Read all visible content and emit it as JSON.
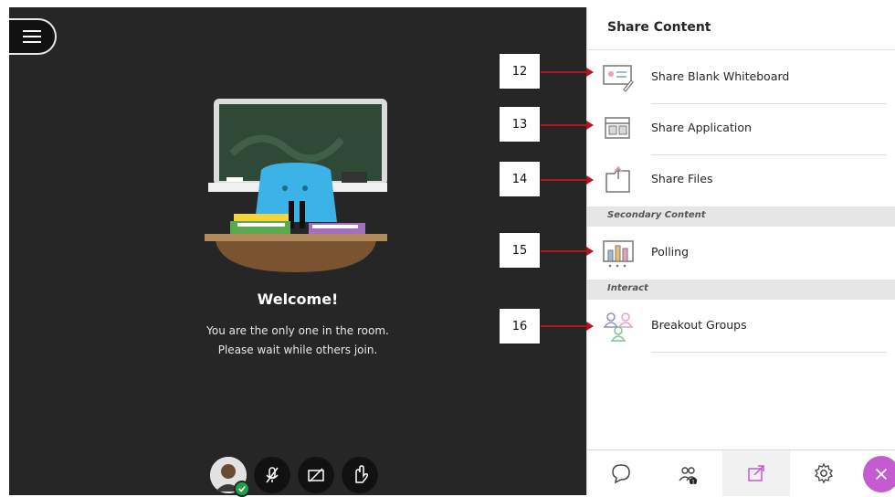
{
  "stage": {
    "welcome_title": "Welcome!",
    "message_line1": "You are the only one in the room.",
    "message_line2": "Please wait while others join."
  },
  "panel": {
    "title": "Share Content",
    "items": [
      {
        "label": "Share Blank Whiteboard",
        "icon": "whiteboard-icon"
      },
      {
        "label": "Share Application",
        "icon": "application-icon"
      },
      {
        "label": "Share Files",
        "icon": "files-icon"
      }
    ],
    "secondary_header": "Secondary Content",
    "secondary_items": [
      {
        "label": "Polling",
        "icon": "polling-icon"
      }
    ],
    "interact_header": "Interact",
    "interact_items": [
      {
        "label": "Breakout Groups",
        "icon": "breakout-groups-icon"
      }
    ]
  },
  "callouts": [
    "12",
    "13",
    "14",
    "15",
    "16"
  ],
  "bottom_bar": {
    "attendees_badge": "1"
  },
  "colors": {
    "stage_bg": "#262626",
    "accent_purple": "#c55bd0",
    "callout_arrow": "#b3141b",
    "status_green": "#21a04a"
  }
}
